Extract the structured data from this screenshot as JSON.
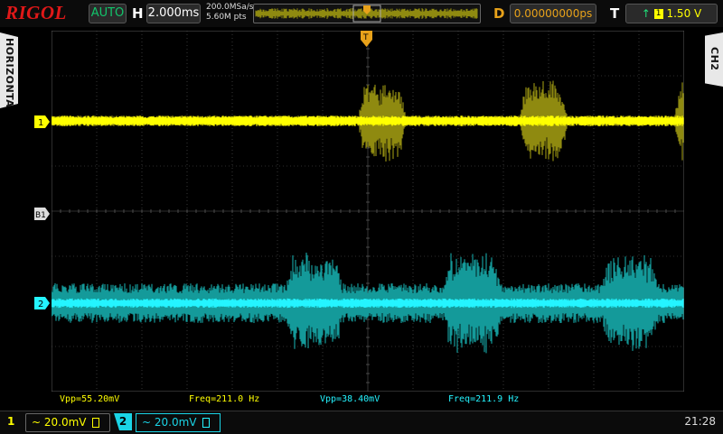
{
  "header": {
    "logo": "RIGOL",
    "run_status": "AUTO",
    "timebase_label": "H",
    "timebase_value": "2.000ms",
    "sample_rate": "200.0MSa/s",
    "memory_depth": "5.60M pts",
    "delay_label": "D",
    "delay_value": "0.00000000ps",
    "trigger_label": "T",
    "trigger_level": "1.50 V",
    "trigger_marker": "T"
  },
  "side_tabs": {
    "left": "HORIZONTAL",
    "right": "CH2"
  },
  "markers": {
    "ch1": "1",
    "ch2": "2",
    "math": "B1",
    "trigger_top": "T"
  },
  "measurements": {
    "ch1_vpp": "Vpp=55.20mV",
    "ch1_freq": "Freq=211.0 Hz",
    "ch2_vpp": "Vpp=38.40mV",
    "ch2_freq": "Freq=211.9 Hz"
  },
  "footer": {
    "ch1_number": "1",
    "ch1_scale": "~ 20.0mV",
    "ch2_number": "2",
    "ch2_scale": "~ 20.0mV",
    "clock": "21:28"
  },
  "colors": {
    "ch1": "#ffff00",
    "ch1_dim": "#8f8a10",
    "ch2": "#24f4ff",
    "ch2_dim": "#149a9a",
    "grid": "#5a5a5a",
    "trigger": "#e8a21a"
  },
  "waveforms": {
    "ch1_bursts": [
      [
        0.485,
        0.56
      ],
      [
        0.74,
        0.815
      ],
      [
        0.985,
        1.065
      ]
    ],
    "ch2_bursts": [
      [
        0.37,
        0.46
      ],
      [
        0.62,
        0.71
      ],
      [
        0.87,
        0.96
      ]
    ]
  }
}
